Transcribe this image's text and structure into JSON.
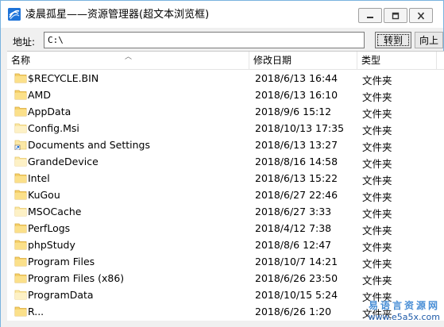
{
  "window": {
    "title": "凌晨孤星——资源管理器(超文本浏览框)"
  },
  "toolbar": {
    "address_label": "地址:",
    "address_value": "C:\\",
    "go_label": "转到",
    "up_label": "向上"
  },
  "list": {
    "columns": {
      "name": "名称",
      "date": "修改日期",
      "type": "类型"
    },
    "rows": [
      {
        "name": "$RECYCLE.BIN",
        "date": "2018/6/13 16:44",
        "type": "文件夹",
        "icon": "folder-icon"
      },
      {
        "name": "AMD",
        "date": "2018/6/13 16:10",
        "type": "文件夹",
        "icon": "folder-icon"
      },
      {
        "name": "AppData",
        "date": "2018/9/6 15:12",
        "type": "文件夹",
        "icon": "folder-icon"
      },
      {
        "name": "Config.Msi",
        "date": "2018/10/13 17:35",
        "type": "文件夹",
        "icon": "folder-icon"
      },
      {
        "name": "Documents and Settings",
        "date": "2018/6/13 13:27",
        "type": "文件夹",
        "icon": "folder-shortcut-icon"
      },
      {
        "name": "GrandeDevice",
        "date": "2018/8/16 14:58",
        "type": "文件夹",
        "icon": "folder-icon"
      },
      {
        "name": "Intel",
        "date": "2018/6/13 15:22",
        "type": "文件夹",
        "icon": "folder-icon"
      },
      {
        "name": "KuGou",
        "date": "2018/6/27 22:46",
        "type": "文件夹",
        "icon": "folder-icon"
      },
      {
        "name": "MSOCache",
        "date": "2018/6/27 3:33",
        "type": "文件夹",
        "icon": "folder-icon"
      },
      {
        "name": "PerfLogs",
        "date": "2018/4/12 7:38",
        "type": "文件夹",
        "icon": "folder-icon"
      },
      {
        "name": "phpStudy",
        "date": "2018/8/6 12:47",
        "type": "文件夹",
        "icon": "folder-icon"
      },
      {
        "name": "Program Files",
        "date": "2018/10/7 14:21",
        "type": "文件夹",
        "icon": "folder-icon"
      },
      {
        "name": "Program Files (x86)",
        "date": "2018/6/26 23:50",
        "type": "文件夹",
        "icon": "folder-icon"
      },
      {
        "name": "ProgramData",
        "date": "2018/10/15 5:24",
        "type": "文件夹",
        "icon": "folder-icon"
      },
      {
        "name": "R...",
        "date": "2018/6/26 1:20",
        "type": "文件夹",
        "icon": "folder-icon"
      }
    ]
  },
  "watermark": {
    "line1": "易语言资源网",
    "line2": "www.e5a5x.com"
  },
  "colors": {
    "folder": "#f5d16b",
    "folder_light": "#fbe8a6",
    "accent": "#1e73d8"
  }
}
